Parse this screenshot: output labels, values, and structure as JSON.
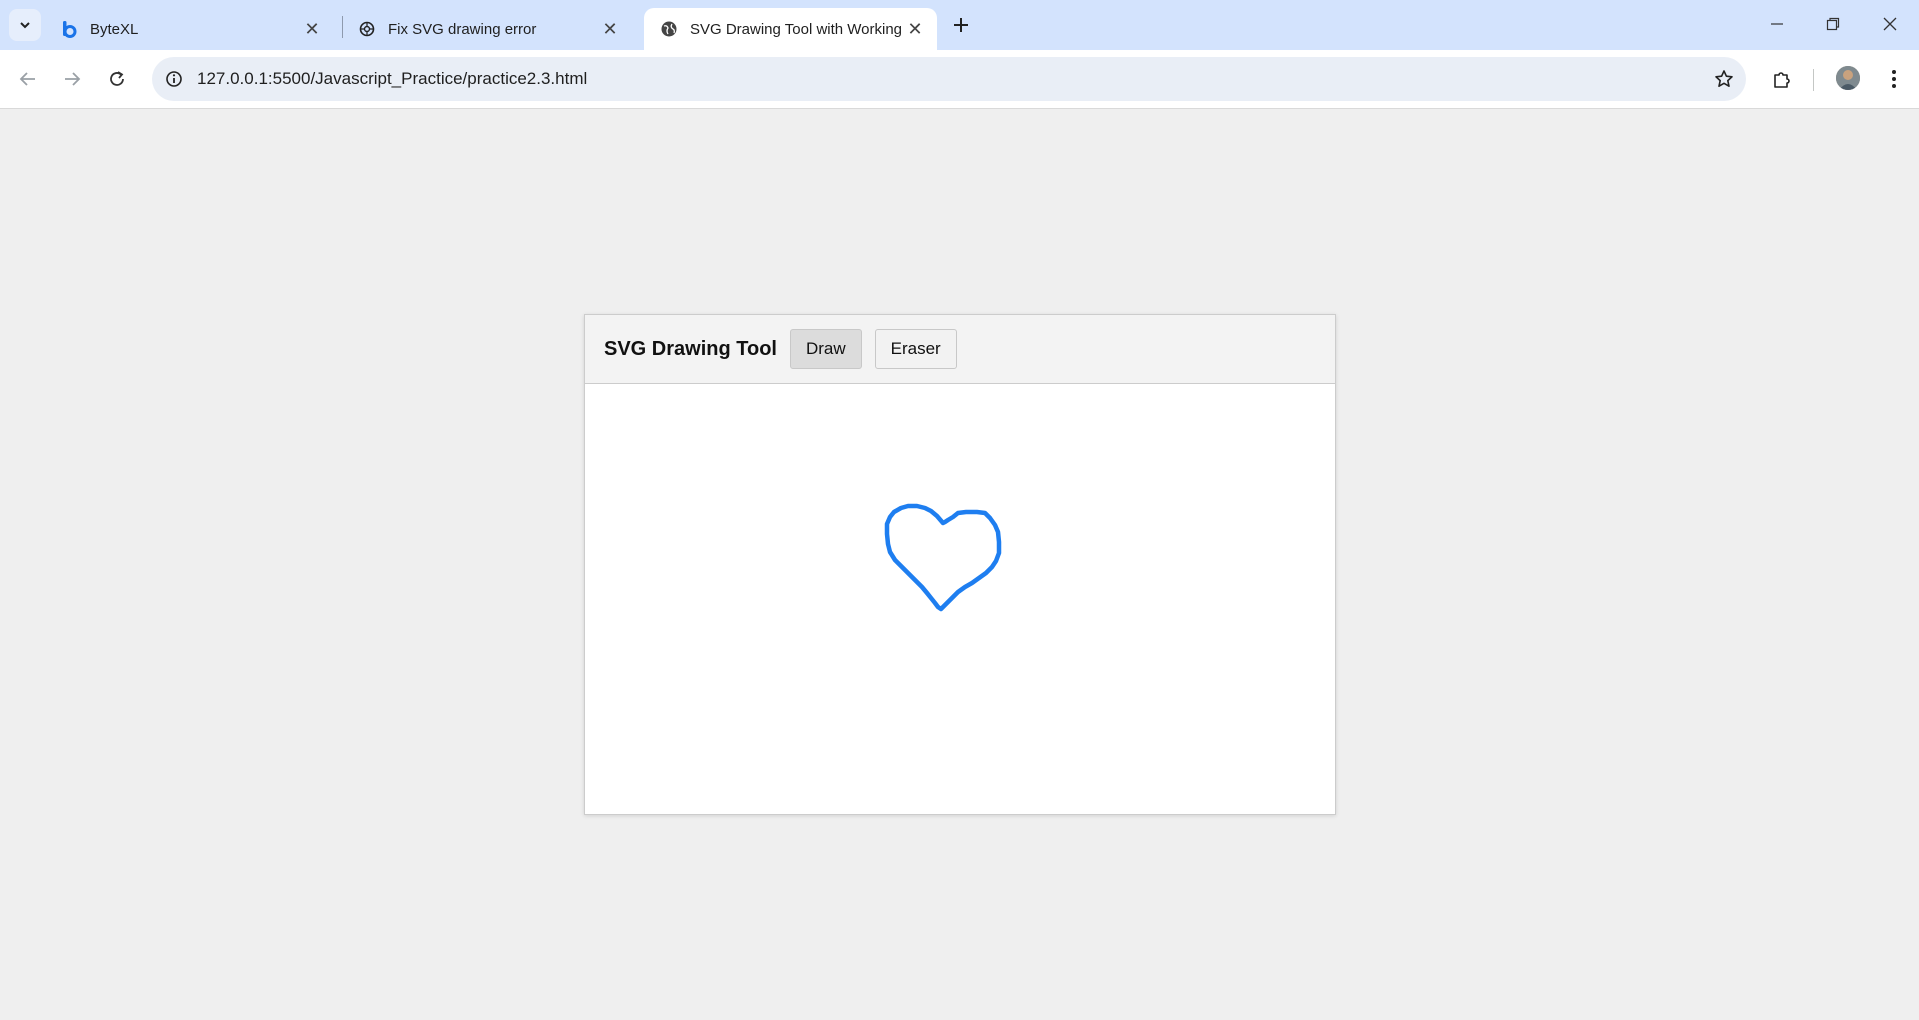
{
  "browser": {
    "tabs": [
      {
        "title": "ByteXL",
        "icon": "bytexl-icon",
        "active": false
      },
      {
        "title": "Fix SVG drawing error",
        "icon": "chatgpt-icon",
        "active": false
      },
      {
        "title": "SVG Drawing Tool with Working",
        "icon": "globe-icon",
        "active": true
      }
    ],
    "url": "127.0.0.1:5500/Javascript_Practice/practice2.3.html",
    "accent": "#d3e3fd"
  },
  "app": {
    "title": "SVG Drawing Tool",
    "draw_label": "Draw",
    "eraser_label": "Eraser",
    "active_tool": "Draw",
    "stroke_color": "#1e7ef0"
  }
}
